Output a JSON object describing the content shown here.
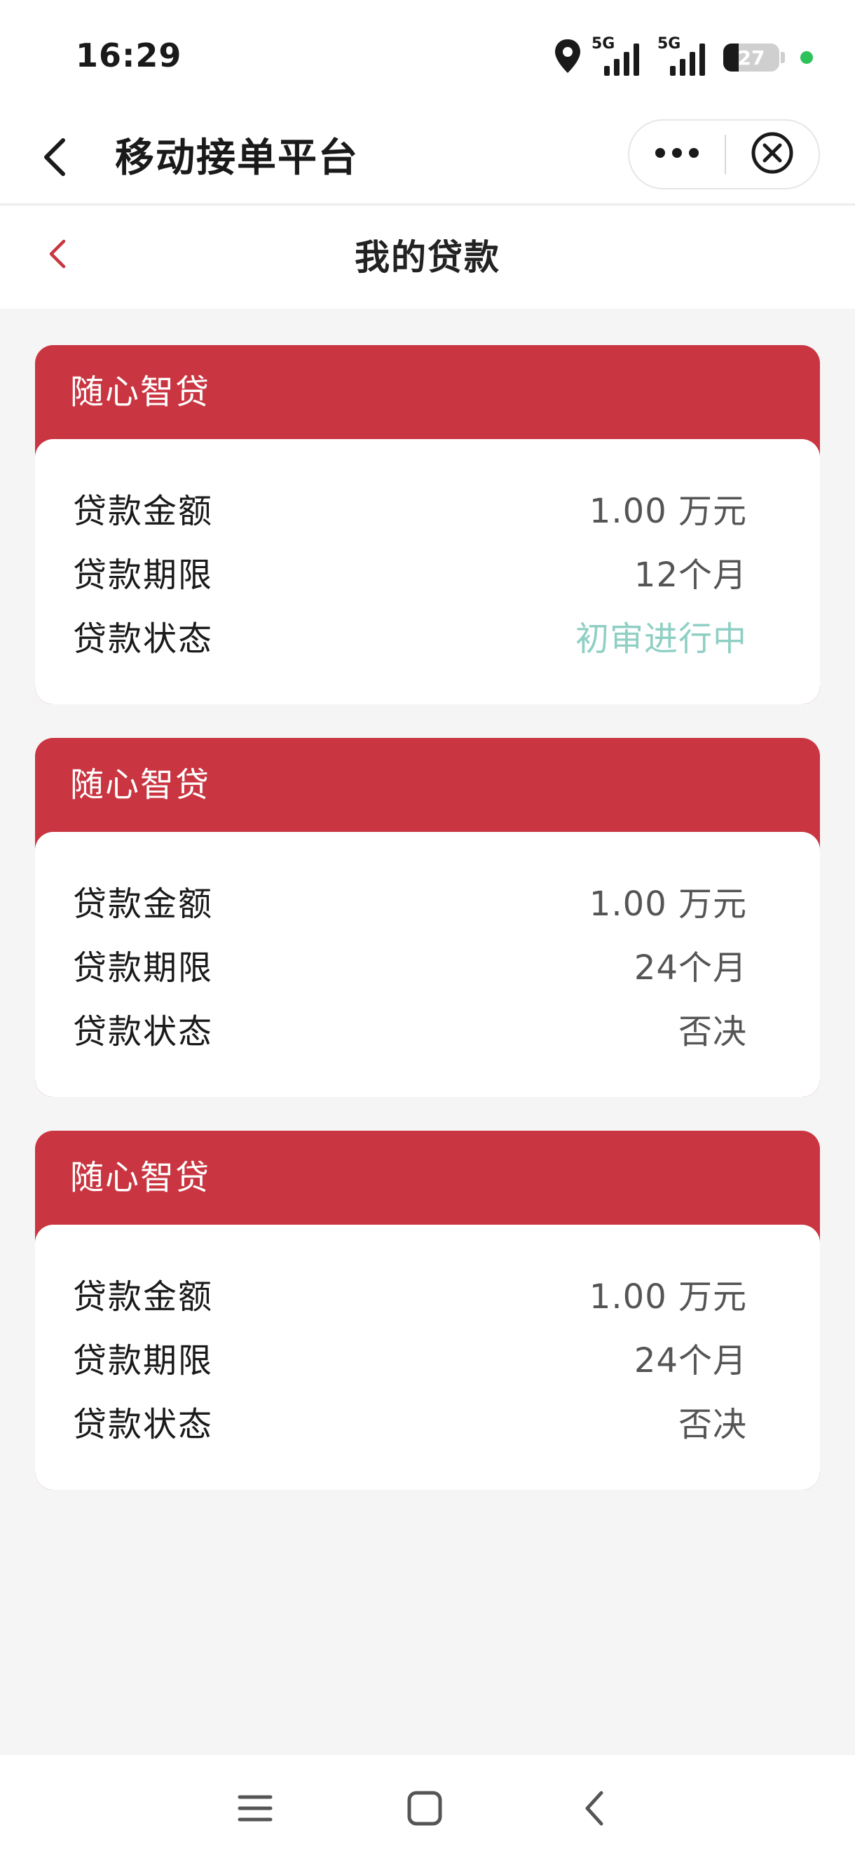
{
  "status_bar": {
    "time": "16:29",
    "signal_1_label": "5G",
    "signal_2_label": "5G",
    "battery_level": 27,
    "battery_text": "27",
    "icons": [
      "location-icon",
      "signal-icon",
      "battery-icon",
      "green-dot-icon"
    ]
  },
  "nav_bar": {
    "title": "移动接单平台",
    "back_icon": "chevron-left-icon",
    "more_icon": "more-dots-icon",
    "close_icon": "close-circle-icon"
  },
  "page": {
    "title": "我的贷款",
    "back_icon": "chevron-left-icon"
  },
  "colors": {
    "accent_red": "#c93540",
    "status_teal": "#8fcfc4",
    "background": "#f5f5f5"
  },
  "loans": [
    {
      "product": "随心智贷",
      "rows": [
        {
          "label": "贷款金额",
          "value": "1.00 万元"
        },
        {
          "label": "贷款期限",
          "value": "12个月"
        },
        {
          "label": "贷款状态",
          "value": "初审进行中"
        }
      ]
    },
    {
      "product": "随心智贷",
      "rows": [
        {
          "label": "贷款金额",
          "value": "1.00 万元"
        },
        {
          "label": "贷款期限",
          "value": "24个月"
        },
        {
          "label": "贷款状态",
          "value": "否决"
        }
      ]
    },
    {
      "product": "随心智贷",
      "rows": [
        {
          "label": "贷款金额",
          "value": "1.00 万元"
        },
        {
          "label": "贷款期限",
          "value": "24个月"
        },
        {
          "label": "贷款状态",
          "value": "否决"
        }
      ]
    }
  ],
  "bottom_nav": {
    "icons": [
      "menu-icon",
      "home-square-icon",
      "back-arrow-icon"
    ]
  }
}
